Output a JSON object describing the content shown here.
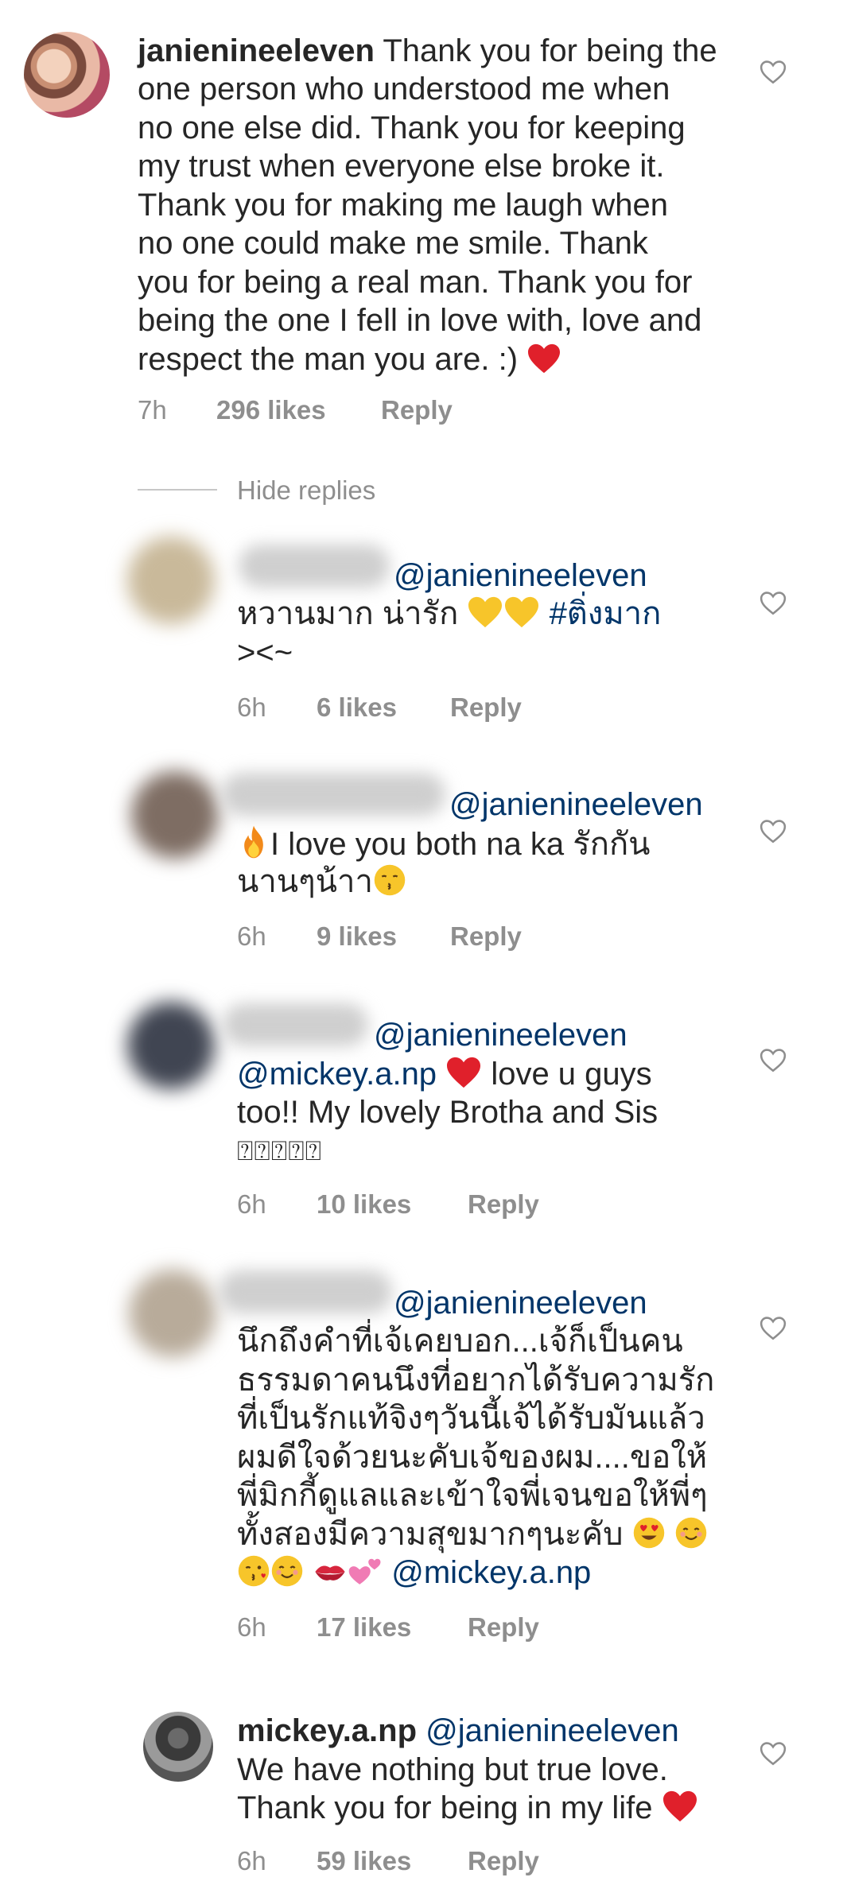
{
  "hide_replies_label": "Hide replies",
  "main_comment": {
    "username": "janienineeleven",
    "lines": [
      "Thank you for being the",
      "one person who understood me when",
      "no one else did. Thank you for keeping",
      "my trust when everyone else broke it.",
      "Thank you for making me laugh when",
      "no one could make me smile. Thank",
      "you for being a real man. Thank you for",
      "being the one I fell in love with, love and",
      "respect the man you are. :)"
    ],
    "time": "7h",
    "likes": "296 likes",
    "reply": "Reply"
  },
  "replies": [
    {
      "mention": "@janienineeleven",
      "line1": "หวานมาก น่ารัก",
      "hashtag": "#ติ่งมาก",
      "line2": "><~",
      "time": "6h",
      "likes": "6 likes",
      "reply": "Reply"
    },
    {
      "mention": "@janienineeleven",
      "line1": "I love you both na ka รักกัน",
      "line2": "นานๆน้าา",
      "time": "6h",
      "likes": "9 likes",
      "reply": "Reply"
    },
    {
      "mention": "@janienineeleven",
      "mention2": "@mickey.a.np",
      "line1": "love  u guys",
      "line2": "too!! My lovely Brotha and Sis",
      "line3": "⍰⍰⍰⍰⍰",
      "time": "6h",
      "likes": "10 likes",
      "reply": "Reply"
    },
    {
      "mention": "@janienineeleven",
      "lines": [
        "นึกถึงคำที่เจ้เคยบอก...เจ้ก็เป็นคน",
        "ธรรมดาคนนึงที่อยากได้รับความรัก",
        "ที่เป็นรักแท้จิงๆวันนี้เจ้ได้รับมันแล้ว",
        "ผมดีใจด้วยนะคับเจ้ของผม....ขอให้",
        "พี่มิกกี้ดูแลและเข้าใจพี่เจนขอให้พี่ๆ",
        "ทั้งสองมีความสุขมากๆนะคับ"
      ],
      "mention2": "@mickey.a.np",
      "time": "6h",
      "likes": "17 likes",
      "reply": "Reply"
    },
    {
      "username": "mickey.a.np",
      "mention": "@janienineeleven",
      "line1": "We have nothing but true love.",
      "line2": "Thank you for being in my life",
      "time": "6h",
      "likes": "59 likes",
      "reply": "Reply"
    }
  ],
  "colors": {
    "text": "#262626",
    "meta": "#8e8e8e",
    "mention": "#003569",
    "heart_red": "#e0202b",
    "heart_yellow": "#f7c52a"
  },
  "icons": [
    "like-heart-icon",
    "red-heart-emoji",
    "yellow-heart-emoji",
    "fire-emoji",
    "kissing-face-emoji",
    "heart-eyes-emoji",
    "smiling-face-emoji",
    "kiss-wink-emoji",
    "kiss-mark-emoji",
    "two-hearts-emoji"
  ]
}
